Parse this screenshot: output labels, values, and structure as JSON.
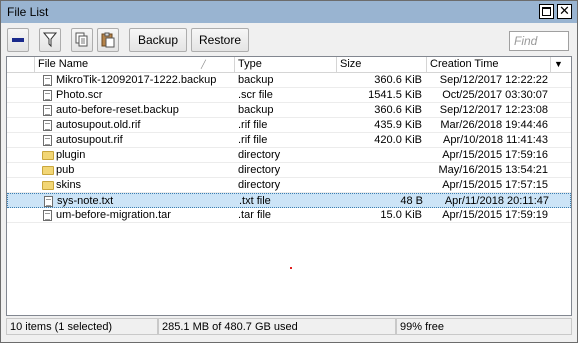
{
  "window": {
    "title": "File List"
  },
  "toolbar": {
    "backup_label": "Backup",
    "restore_label": "Restore",
    "find_placeholder": "Find"
  },
  "table": {
    "columns": [
      "File Name",
      "Type",
      "Size",
      "Creation Time"
    ],
    "rows": [
      {
        "name": "MikroTik-12092017-1222.backup",
        "type": "backup",
        "size": "360.6 KiB",
        "time": "Sep/12/2017 12:22:22",
        "kind": "file"
      },
      {
        "name": "Photo.scr",
        "type": ".scr file",
        "size": "1541.5 KiB",
        "time": "Oct/25/2017 03:30:07",
        "kind": "file"
      },
      {
        "name": "auto-before-reset.backup",
        "type": "backup",
        "size": "360.6 KiB",
        "time": "Sep/12/2017 12:23:08",
        "kind": "file"
      },
      {
        "name": "autosupout.old.rif",
        "type": ".rif file",
        "size": "435.9 KiB",
        "time": "Mar/26/2018 19:44:46",
        "kind": "file"
      },
      {
        "name": "autosupout.rif",
        "type": ".rif file",
        "size": "420.0 KiB",
        "time": "Apr/10/2018 11:41:43",
        "kind": "file"
      },
      {
        "name": "plugin",
        "type": "directory",
        "size": "",
        "time": "Apr/15/2015 17:59:16",
        "kind": "dir"
      },
      {
        "name": "pub",
        "type": "directory",
        "size": "",
        "time": "May/16/2015 13:54:21",
        "kind": "dir"
      },
      {
        "name": "skins",
        "type": "directory",
        "size": "",
        "time": "Apr/15/2015 17:57:15",
        "kind": "dir"
      },
      {
        "name": "sys-note.txt",
        "type": ".txt file",
        "size": "48 B",
        "time": "Apr/11/2018 20:11:47",
        "kind": "file",
        "selected": true
      },
      {
        "name": "um-before-migration.tar",
        "type": ".tar file",
        "size": "15.0 KiB",
        "time": "Apr/15/2015 17:59:19",
        "kind": "file"
      }
    ]
  },
  "status": {
    "count": "10 items (1 selected)",
    "usage": "285.1 MB of 480.7 GB used",
    "free": "99% free"
  },
  "colors": {
    "titlebar": "#99b4d1",
    "selection": "#cce4f7",
    "folder": "#f2d675"
  },
  "icons": [
    "maximize-icon",
    "close-icon",
    "minus-icon",
    "filter-icon",
    "copy-icon",
    "paste-icon",
    "file-icon",
    "folder-icon",
    "sort-desc-icon",
    "dropdown-icon"
  ]
}
